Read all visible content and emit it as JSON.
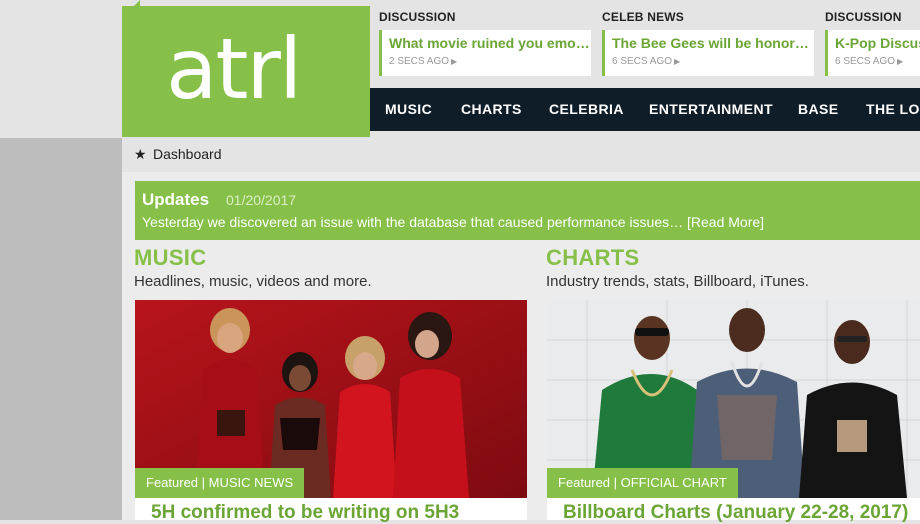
{
  "logo": {
    "text": "atrl"
  },
  "feed": [
    {
      "category": "DISCUSSION",
      "title": "What movie ruined you emo…",
      "time": "2 SECS AGO"
    },
    {
      "category": "CELEB NEWS",
      "title": "The Bee Gees will be honor…",
      "time": "6 SECS AGO"
    },
    {
      "category": "DISCUSSION",
      "title": "K-Pop Discus",
      "time": "6 SECS AGO"
    }
  ],
  "nav": [
    "MUSIC",
    "CHARTS",
    "CELEBRIA",
    "ENTERTAINMENT",
    "BASE",
    "THE LOU"
  ],
  "breadcrumb": {
    "label": "Dashboard",
    "icon": "star-icon"
  },
  "updates": {
    "title": "Updates",
    "date": "01/20/2017",
    "text": "Yesterday we discovered an issue with the database that caused performance issues… [Read More]"
  },
  "sections": [
    {
      "title": "MUSIC",
      "subtitle": "Headlines, music, videos and more.",
      "tag": "Featured | MUSIC NEWS",
      "headline": "5H confirmed to be writing on 5H3"
    },
    {
      "title": "CHARTS",
      "subtitle": "Industry trends, stats, Billboard, iTunes.",
      "tag": "Featured | OFFICIAL CHART",
      "headline": "Billboard Charts (January 22-28, 2017)"
    }
  ],
  "colors": {
    "accent": "#86c048",
    "nav_bg": "#0f1d29",
    "link": "#6aa535"
  }
}
